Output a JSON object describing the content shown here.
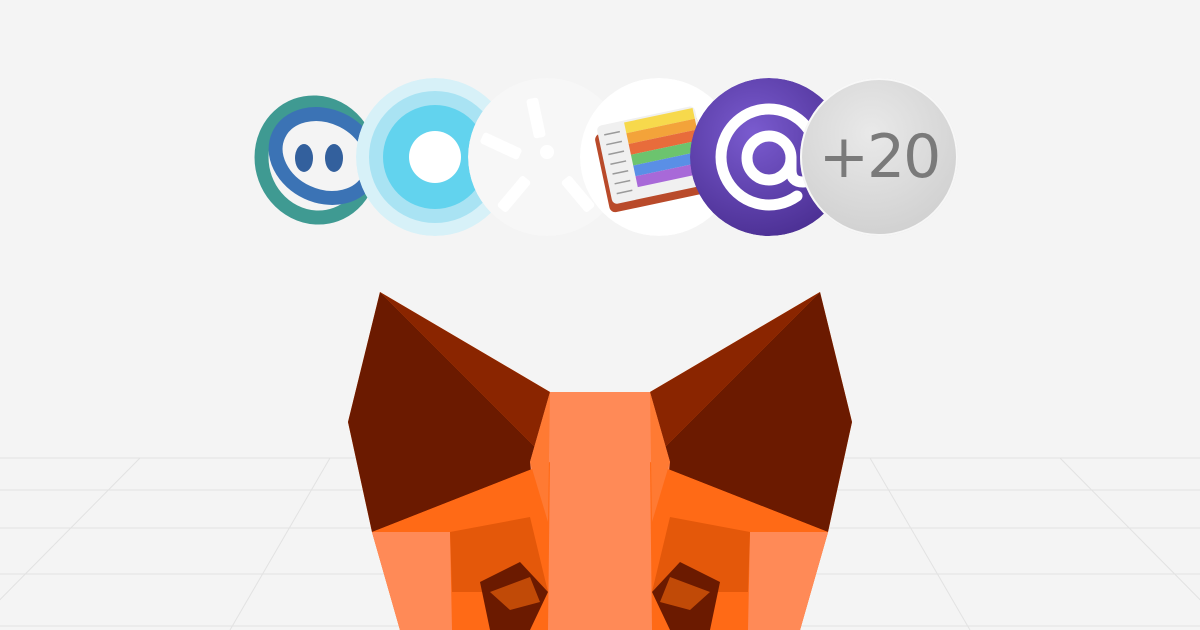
{
  "background": {
    "color": "#f4f4f4",
    "grid_color": "#e2e2e2"
  },
  "wallet_icons": [
    {
      "icon": "blue-teal-smiley-face-icon",
      "colors": [
        "#3b7dbf",
        "#3fa38c"
      ]
    },
    {
      "icon": "light-blue-ring-icon",
      "colors": [
        "#4fd0ee",
        "#bfeaf6"
      ]
    },
    {
      "icon": "white-asterisk-logo-icon",
      "colors": [
        "#ffffff"
      ]
    },
    {
      "icon": "rainbow-book-icon",
      "colors": [
        "#e86c3b",
        "#f7d94c",
        "#6cc46e",
        "#5a8fe6",
        "#a869d8"
      ]
    },
    {
      "icon": "purple-at-sign-icon",
      "colors": [
        "#5a3fa3",
        "#ffffff"
      ]
    }
  ],
  "more_badge": {
    "label": "+20",
    "color": "#7a7a7a"
  },
  "mascot": {
    "icon": "metamask-fox-icon",
    "colors": {
      "dark_ear": "#6b1a00",
      "orange": "#ff6a16",
      "light_orange": "#ff8a57",
      "mid_orange": "#e4580a",
      "deep": "#c14a07"
    }
  }
}
